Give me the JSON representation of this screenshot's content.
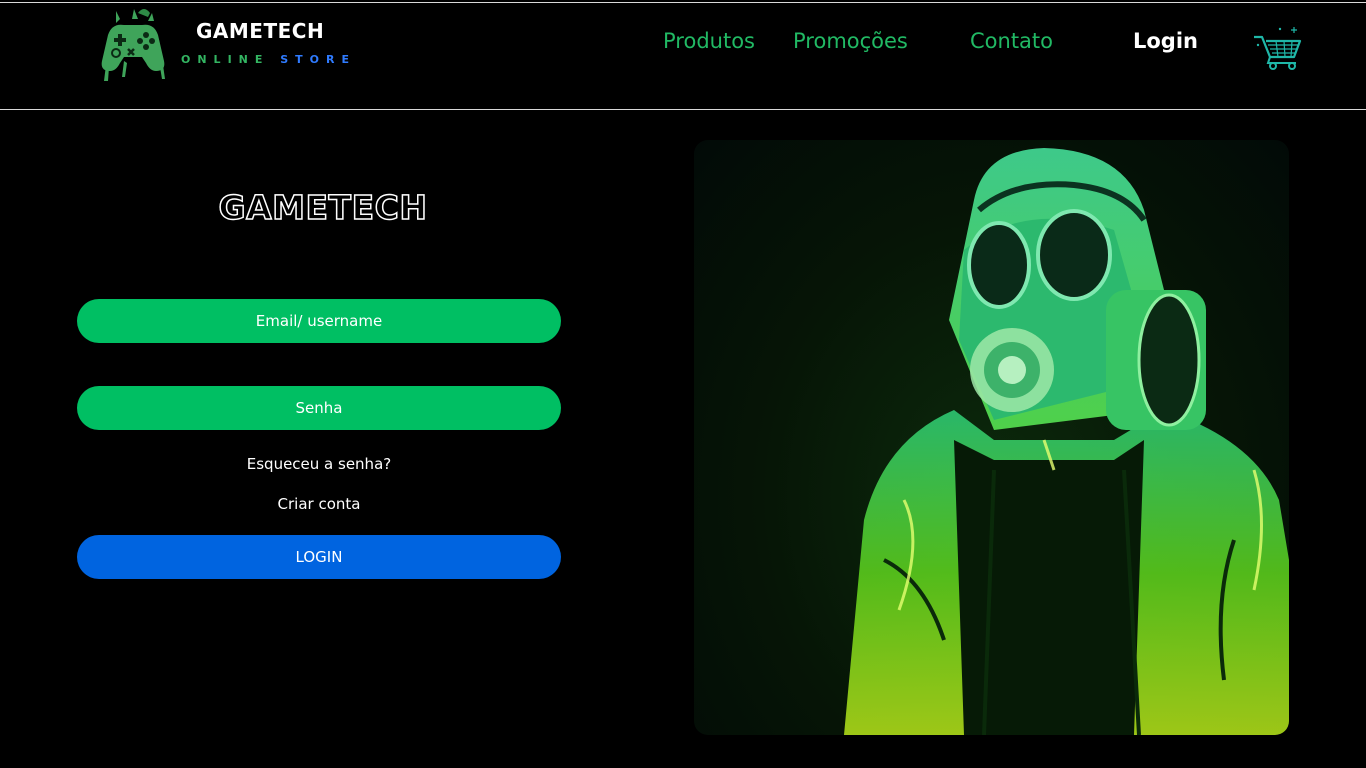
{
  "header": {
    "logo": {
      "title": "GAMETECH",
      "subtitle_part1": "ONLINE",
      "subtitle_part2": "STORE",
      "icon": "gamepad-icon"
    },
    "nav": {
      "produtos": "Produtos",
      "promocoes": "Promoções",
      "contato": "Contato",
      "login": "Login"
    },
    "cart_icon": "shopping-cart-icon"
  },
  "login_form": {
    "brand": "GAMETECH",
    "email_placeholder": "Email/ username",
    "password_placeholder": "Senha",
    "forgot_password": "Esqueceu a senha?",
    "create_account": "Criar conta",
    "login_button": "LOGIN"
  },
  "hero": {
    "image": "gas-mask-figure-illustration"
  },
  "colors": {
    "background": "#000000",
    "nav_green": "#21b964",
    "input_green": "#00bf63",
    "button_blue": "#0064e0",
    "store_blue": "#2f7bff"
  }
}
